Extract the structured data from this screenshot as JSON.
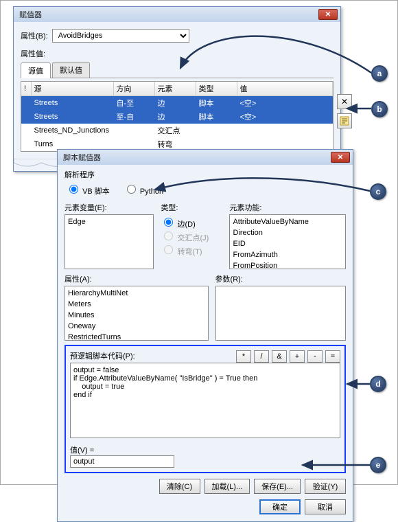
{
  "top": {
    "title": "赋值器",
    "prop_label": "属性(B):",
    "combo_value": "AvoidBridges",
    "values_label": "属性值:",
    "tabs": [
      "源值",
      "默认值"
    ],
    "cols": {
      "bang": "!",
      "src": "源",
      "dir": "方向",
      "elem": "元素",
      "type": "类型",
      "val": "值"
    },
    "rows": [
      {
        "src": "Streets",
        "dir": "自-至",
        "elem": "边",
        "type": "脚本",
        "val": "<空>",
        "sel": true
      },
      {
        "src": "Streets",
        "dir": "至-自",
        "elem": "边",
        "type": "脚本",
        "val": "<空>",
        "sel": true
      },
      {
        "src": "Streets_ND_Junctions",
        "dir": "",
        "elem": "交汇点",
        "type": "",
        "val": "",
        "sel": false
      },
      {
        "src": "Turns",
        "dir": "",
        "elem": "转弯",
        "type": "",
        "val": "",
        "sel": false
      }
    ]
  },
  "parser": {
    "title": "脚本赋值器",
    "section": "解析程序",
    "radio_vb": "VB 脚本",
    "radio_py": "Python",
    "var_label": "元素变量(E):",
    "var_items": [
      "Edge"
    ],
    "type_label": "类型:",
    "type_radios": {
      "edge": "边(D)",
      "jct": "交汇点(J)",
      "turn": "转弯(T)"
    },
    "func_label": "元素功能:",
    "func_items": [
      "AttributeValueByName",
      "Direction",
      "EID",
      "FromAzimuth",
      "FromPosition"
    ],
    "attr_label": "属性(A):",
    "attr_items": [
      "HierarchyMultiNet",
      "Meters",
      "Minutes",
      "Oneway",
      "RestrictedTurns"
    ],
    "param_label": "参数(R):",
    "prelogic_label": "预逻辑脚本代码(P):",
    "ops": [
      "*",
      "/",
      "&",
      "+",
      "-",
      "="
    ],
    "code": "output = false\nif Edge.AttributeValueByName( \"IsBridge\" ) = True then\n    output = true\nend if",
    "value_label": "值(V) =",
    "value_expr": "output",
    "buttons": {
      "clear": "清除(C)",
      "load": "加载(L)...",
      "save": "保存(E)...",
      "verify": "验证(Y)",
      "ok": "确定",
      "cancel": "取消"
    }
  },
  "callouts": {
    "a": "a",
    "b": "b",
    "c": "c",
    "d": "d",
    "e": "e"
  }
}
